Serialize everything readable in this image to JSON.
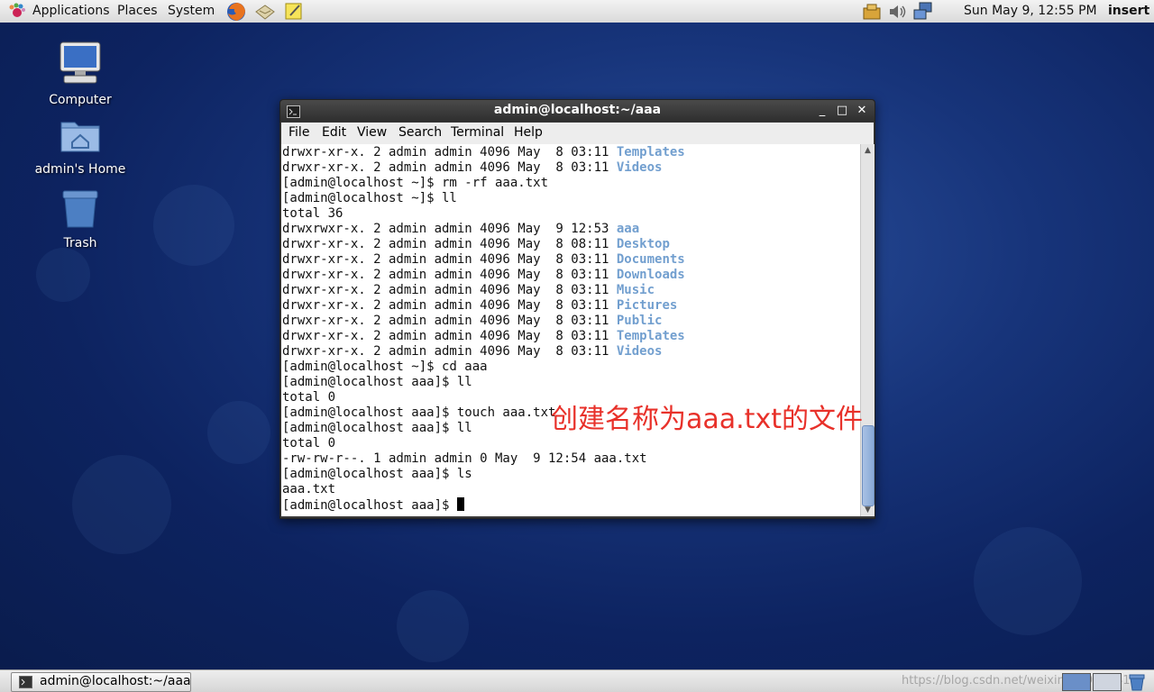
{
  "top_panel": {
    "menus": [
      "Applications",
      "Places",
      "System"
    ],
    "clock": "Sun May  9, 12:55 PM",
    "keyboard_mode": "insert"
  },
  "desktop": {
    "icons": [
      {
        "label": "Computer",
        "icon": "computer-icon"
      },
      {
        "label": "admin's Home",
        "icon": "home-folder-icon"
      },
      {
        "label": "Trash",
        "icon": "trash-icon"
      }
    ]
  },
  "terminal": {
    "title": "admin@localhost:~/aaa",
    "menu": [
      "File",
      "Edit",
      "View",
      "Search",
      "Terminal",
      "Help"
    ],
    "lines": [
      {
        "text": "drwxr-xr-x. 2 admin admin 4096 May  8 03:11 ",
        "dir": "Templates"
      },
      {
        "text": "drwxr-xr-x. 2 admin admin 4096 May  8 03:11 ",
        "dir": "Videos"
      },
      {
        "text": "[admin@localhost ~]$ rm -rf aaa.txt",
        "dir": ""
      },
      {
        "text": "[admin@localhost ~]$ ll",
        "dir": ""
      },
      {
        "text": "total 36",
        "dir": ""
      },
      {
        "text": "drwxrwxr-x. 2 admin admin 4096 May  9 12:53 ",
        "dir": "aaa"
      },
      {
        "text": "drwxr-xr-x. 2 admin admin 4096 May  8 08:11 ",
        "dir": "Desktop"
      },
      {
        "text": "drwxr-xr-x. 2 admin admin 4096 May  8 03:11 ",
        "dir": "Documents"
      },
      {
        "text": "drwxr-xr-x. 2 admin admin 4096 May  8 03:11 ",
        "dir": "Downloads"
      },
      {
        "text": "drwxr-xr-x. 2 admin admin 4096 May  8 03:11 ",
        "dir": "Music"
      },
      {
        "text": "drwxr-xr-x. 2 admin admin 4096 May  8 03:11 ",
        "dir": "Pictures"
      },
      {
        "text": "drwxr-xr-x. 2 admin admin 4096 May  8 03:11 ",
        "dir": "Public"
      },
      {
        "text": "drwxr-xr-x. 2 admin admin 4096 May  8 03:11 ",
        "dir": "Templates"
      },
      {
        "text": "drwxr-xr-x. 2 admin admin 4096 May  8 03:11 ",
        "dir": "Videos"
      },
      {
        "text": "[admin@localhost ~]$ cd aaa",
        "dir": ""
      },
      {
        "text": "[admin@localhost aaa]$ ll",
        "dir": ""
      },
      {
        "text": "total 0",
        "dir": ""
      },
      {
        "text": "[admin@localhost aaa]$ touch aaa.txt",
        "dir": ""
      },
      {
        "text": "[admin@localhost aaa]$ ll",
        "dir": ""
      },
      {
        "text": "total 0",
        "dir": ""
      },
      {
        "text": "-rw-rw-r--. 1 admin admin 0 May  9 12:54 aaa.txt",
        "dir": ""
      },
      {
        "text": "[admin@localhost aaa]$ ls",
        "dir": ""
      },
      {
        "text": "aaa.txt",
        "dir": ""
      },
      {
        "text": "[admin@localhost aaa]$ ",
        "dir": ""
      }
    ],
    "dir_color": "#729fcf"
  },
  "annotation": {
    "text": "创建名称为aaa.txt的文件",
    "color": "#e8312a"
  },
  "taskbar": {
    "window_button": "admin@localhost:~/aaa",
    "watermark": "https://blog.csdn.net/weixin_44903341"
  }
}
